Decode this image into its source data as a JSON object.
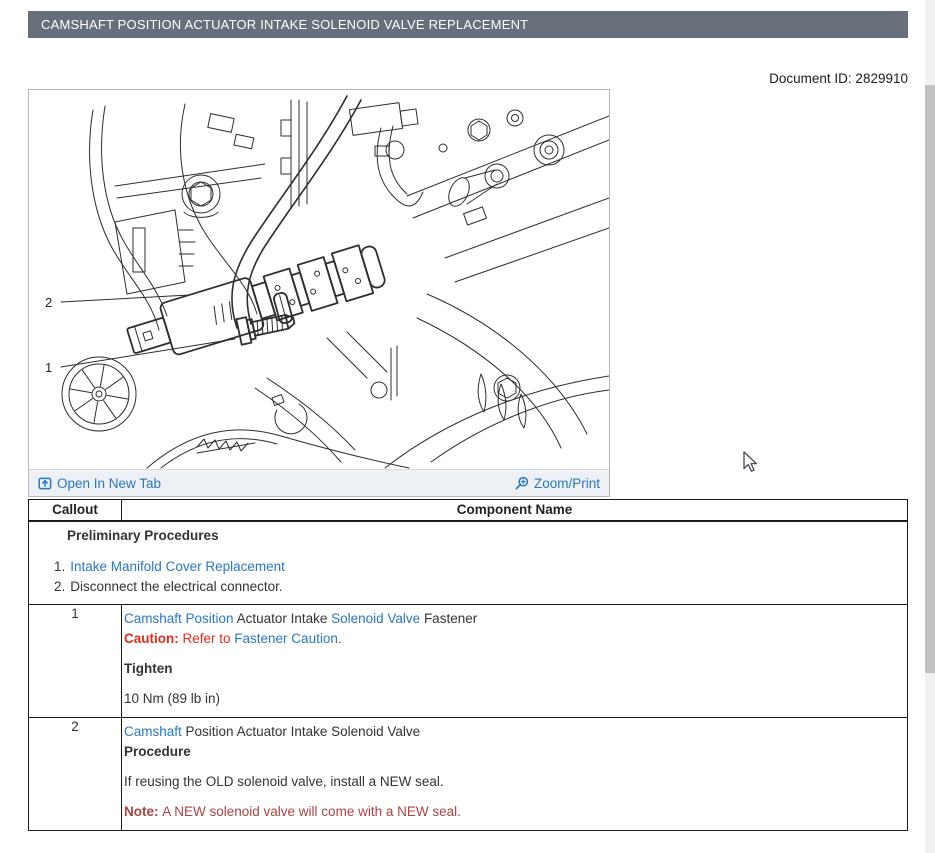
{
  "palette": {
    "title_bar_bg": "#67707a",
    "link_blue": "#2b77c0",
    "caution_red": "#e32b1e",
    "note_red": "#a94442",
    "text": "#333333"
  },
  "title_bar": {
    "title": "CAMSHAFT POSITION ACTUATOR INTAKE SOLENOID VALVE REPLACEMENT"
  },
  "document": {
    "id_text": "Document ID: 2829910"
  },
  "image_panel": {
    "callouts": [
      {
        "label": "1"
      },
      {
        "label": "2"
      }
    ],
    "footer": {
      "open_in_new_tab": "Open In New Tab",
      "zoom_print": "Zoom/Print"
    }
  },
  "table": {
    "headers": [
      "Callout",
      "Component Name"
    ],
    "preliminary": {
      "title": "Preliminary Procedures",
      "items": [
        {
          "number": "1.",
          "segments": [
            {
              "text": "Intake Manifold Cover Replacement",
              "style": "link"
            }
          ]
        },
        {
          "number": "2.",
          "segments": [
            {
              "text": "Disconnect the electrical connector.",
              "style": "plain"
            }
          ]
        }
      ]
    },
    "rows": [
      {
        "callout": "1",
        "lines": [
          {
            "segments": [
              {
                "text": "Camshaft Position",
                "style": "link"
              },
              {
                "text": " Actuator Intake ",
                "style": "plain"
              },
              {
                "text": "Solenoid Valve",
                "style": "link"
              },
              {
                "text": " Fastener",
                "style": "plain"
              }
            ]
          },
          {
            "segments": [
              {
                "text": "Caution: ",
                "style": "caution-bold"
              },
              {
                "text": "Refer to ",
                "style": "caution"
              },
              {
                "text": "Fastener Caution",
                "style": "link"
              },
              {
                "text": ".",
                "style": "caution"
              }
            ]
          },
          {
            "gap": true,
            "segments": [
              {
                "text": "Tighten",
                "style": "bold"
              }
            ]
          },
          {
            "gap": true,
            "segments": [
              {
                "text": "10 Nm  (89 lb in)",
                "style": "plain"
              }
            ]
          }
        ]
      },
      {
        "callout": "2",
        "lines": [
          {
            "segments": [
              {
                "text": "Camshaft",
                "style": "link"
              },
              {
                "text": " Position Actuator Intake Solenoid Valve",
                "style": "plain"
              }
            ]
          },
          {
            "segments": [
              {
                "text": "Procedure",
                "style": "bold"
              }
            ]
          },
          {
            "gap": true,
            "segments": [
              {
                "text": "If reusing the OLD solenoid valve, install a NEW seal.",
                "style": "plain"
              }
            ]
          },
          {
            "gap": true,
            "segments": [
              {
                "text": "Note: ",
                "style": "note-bold"
              },
              {
                "text": "A NEW solenoid valve will come with a NEW seal.",
                "style": "note"
              }
            ]
          }
        ]
      }
    ]
  }
}
